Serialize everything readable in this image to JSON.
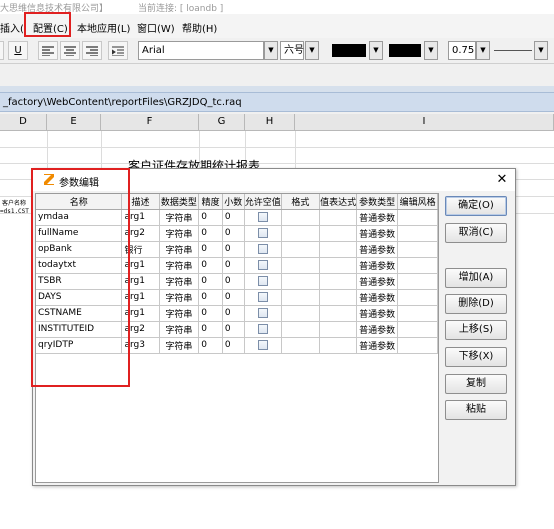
{
  "titlebar": {
    "app_name": "大思维信息技术有限公司】",
    "connection": "当前连接: [ loandb ]"
  },
  "menu": {
    "items": [
      "插入(",
      "配置(C)",
      "本地应用(L)",
      "窗口(W)",
      "帮助(H)"
    ]
  },
  "toolbar": {
    "underline_label": "U",
    "font_name": "Arial",
    "font_size": "六号",
    "line_width": "0.75",
    "text_color": "#000000",
    "fill_color": "#000000"
  },
  "file_path": "_factory\\WebContent\\reportFiles\\GRZJDQ_tc.raq",
  "sheet": {
    "columns": [
      "D",
      "E",
      "F",
      "G",
      "H",
      "I"
    ],
    "title_text": "客户证件存放期统计报表",
    "cell_header": "客户名称",
    "cell_expr": "=ds1.CST"
  },
  "dialog": {
    "title": "参数编辑",
    "close_symbol": "✕",
    "columns": [
      "名称",
      "描述",
      "数据类型",
      "精度",
      "小数",
      "允许空值",
      "格式",
      "值表达式",
      "参数类型",
      "编辑风格"
    ],
    "rows": [
      {
        "name": "ymdaa",
        "desc": "arg1",
        "dtype": "字符串",
        "precision": "0",
        "scale": "0",
        "nullable": false,
        "fmt": "",
        "expr": "",
        "ptype": "普通参数",
        "style": ""
      },
      {
        "name": "fullName",
        "desc": "arg2",
        "dtype": "字符串",
        "precision": "0",
        "scale": "0",
        "nullable": false,
        "fmt": "",
        "expr": "",
        "ptype": "普通参数",
        "style": ""
      },
      {
        "name": "opBank",
        "desc": "银行",
        "dtype": "字符串",
        "precision": "0",
        "scale": "0",
        "nullable": false,
        "fmt": "",
        "expr": "",
        "ptype": "普通参数",
        "style": ""
      },
      {
        "name": "todaytxt",
        "desc": "arg1",
        "dtype": "字符串",
        "precision": "0",
        "scale": "0",
        "nullable": false,
        "fmt": "",
        "expr": "",
        "ptype": "普通参数",
        "style": ""
      },
      {
        "name": "TSBR",
        "desc": "arg1",
        "dtype": "字符串",
        "precision": "0",
        "scale": "0",
        "nullable": false,
        "fmt": "",
        "expr": "",
        "ptype": "普通参数",
        "style": ""
      },
      {
        "name": "DAYS",
        "desc": "arg1",
        "dtype": "字符串",
        "precision": "0",
        "scale": "0",
        "nullable": false,
        "fmt": "",
        "expr": "",
        "ptype": "普通参数",
        "style": ""
      },
      {
        "name": "CSTNAME",
        "desc": "arg1",
        "dtype": "字符串",
        "precision": "0",
        "scale": "0",
        "nullable": false,
        "fmt": "",
        "expr": "",
        "ptype": "普通参数",
        "style": ""
      },
      {
        "name": "INSTITUTEID",
        "desc": "arg2",
        "dtype": "字符串",
        "precision": "0",
        "scale": "0",
        "nullable": false,
        "fmt": "",
        "expr": "",
        "ptype": "普通参数",
        "style": ""
      },
      {
        "name": "qryIDTP",
        "desc": "arg3",
        "dtype": "字符串",
        "precision": "0",
        "scale": "0",
        "nullable": false,
        "fmt": "",
        "expr": "",
        "ptype": "普通参数",
        "style": ""
      }
    ],
    "buttons": {
      "ok": "确定(O)",
      "cancel": "取消(C)",
      "add": "增加(A)",
      "delete": "删除(D)",
      "move_up": "上移(S)",
      "move_down": "下移(X)",
      "copy": "复制",
      "paste": "粘贴"
    }
  },
  "colors": {
    "highlight": "#e02020",
    "path_bar": "#cfdced"
  }
}
